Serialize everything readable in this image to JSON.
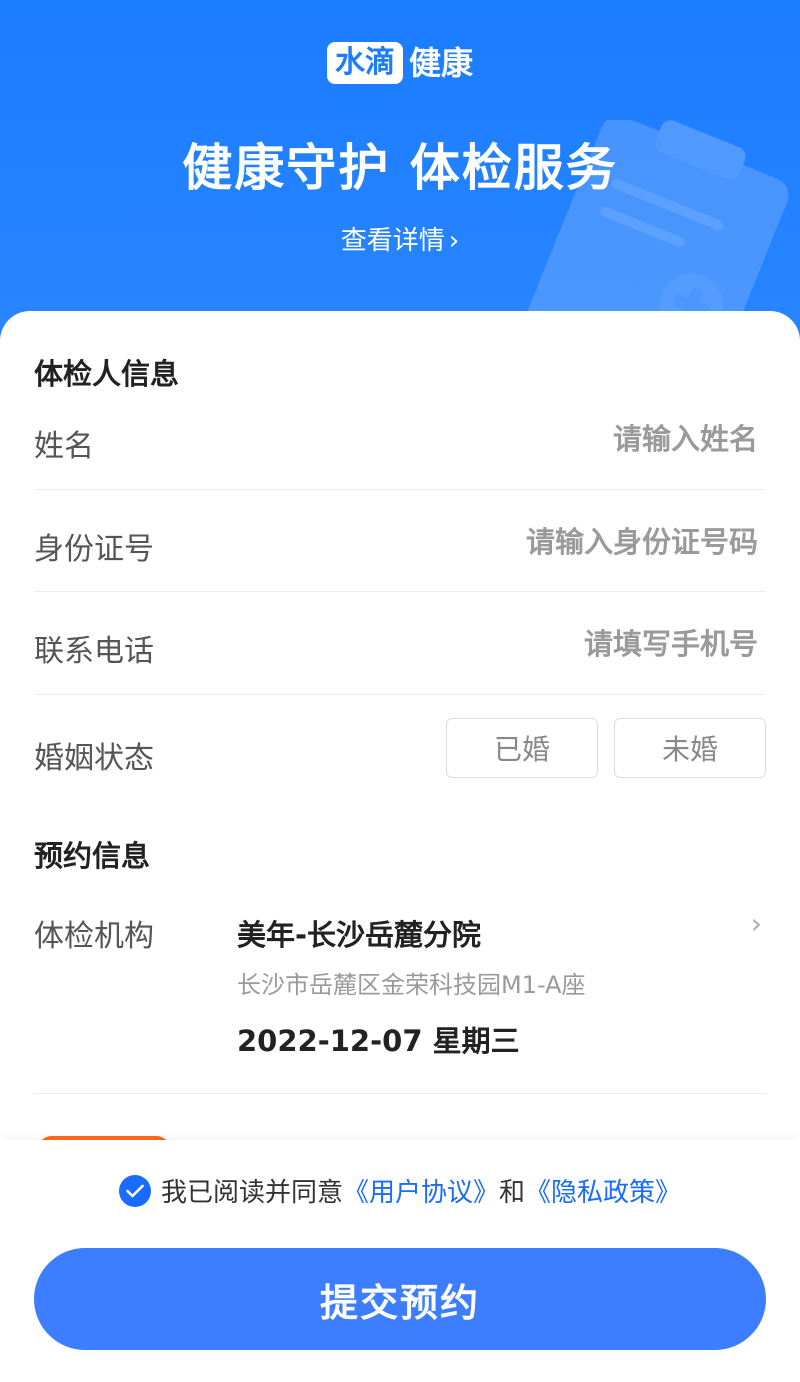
{
  "header": {
    "logo_badge": "水滴",
    "logo_text": "健康",
    "title": "健康守护 体检服务",
    "detail_link": "查看详情"
  },
  "examinee": {
    "section_title": "体检人信息",
    "name_label": "姓名",
    "name_placeholder": "请输入姓名",
    "id_label": "身份证号",
    "id_placeholder": "请输入身份证号码",
    "phone_label": "联系电话",
    "phone_placeholder": "请填写手机号",
    "marital_label": "婚姻状态",
    "marital_options": [
      "已婚",
      "未婚"
    ]
  },
  "booking": {
    "section_title": "预约信息",
    "institution_label": "体检机构",
    "institution_name": "美年-长沙岳麓分院",
    "institution_address": "长沙市岳麓区金荣科技园M1-A座",
    "date": "2022-12-07 星期三"
  },
  "footer": {
    "agree_prefix": "我已阅读并同意",
    "user_agreement": "《用户协议》",
    "and": "和",
    "privacy_policy": "《隐私政策》",
    "submit": "提交预约"
  },
  "colors": {
    "primary": "#1a7cff",
    "button": "#3d7dff",
    "accent": "#ff6a1a"
  },
  "icons": {
    "detail_chevron": "chevron-right-icon",
    "institution_chevron": "chevron-right-icon",
    "agree_check": "check-circle-icon",
    "decoration": "medical-clipboard-icon"
  }
}
